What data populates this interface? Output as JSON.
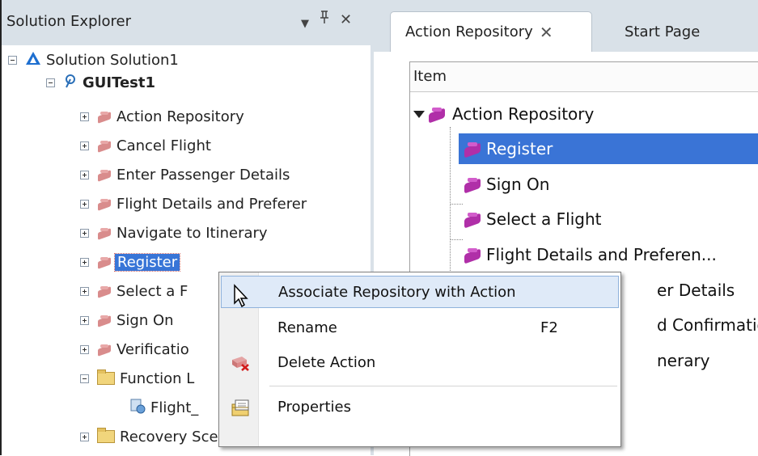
{
  "solution_explorer": {
    "title": "Solution Explorer",
    "header_buttons": {
      "dropdown": "▼",
      "pin": "ᛡ",
      "close": "✕"
    },
    "tree": [
      {
        "label": "Solution Solution1",
        "icon": "solution-icon",
        "expanded": true
      },
      {
        "label": "GUITest1",
        "icon": "test-icon",
        "expanded": true,
        "bold": true
      },
      {
        "label": "Action Repository",
        "icon": "action-icon"
      },
      {
        "label": "Cancel Flight",
        "icon": "action-icon"
      },
      {
        "label": "Enter Passenger Details",
        "icon": "action-icon"
      },
      {
        "label": "Flight Details and Preferer",
        "icon": "action-icon"
      },
      {
        "label": "Navigate to Itinerary",
        "icon": "action-icon"
      },
      {
        "label": "Register",
        "icon": "action-icon",
        "selected": true
      },
      {
        "label": "Select a F",
        "icon": "action-icon"
      },
      {
        "label": "Sign On",
        "icon": "action-icon"
      },
      {
        "label": "Verificatio",
        "icon": "action-icon"
      },
      {
        "label": "Function L",
        "icon": "folder-icon",
        "expanded": true
      },
      {
        "label": "Flight_",
        "icon": "function-library-icon"
      },
      {
        "label": "Recovery Scenarios",
        "icon": "folder-icon"
      }
    ]
  },
  "tabs": [
    {
      "label": "Action Repository",
      "active": true,
      "close": "✕"
    },
    {
      "label": "Start Page",
      "active": false
    }
  ],
  "repository_grid": {
    "column_header": "Item",
    "root": "Action Repository",
    "items": [
      {
        "label": "Register",
        "selected": true
      },
      {
        "label": "Sign On"
      },
      {
        "label": "Select a Flight"
      },
      {
        "label": "Flight Details and Preferen..."
      },
      {
        "label": "er Details"
      },
      {
        "label": "d Confirmation"
      },
      {
        "label": "nerary"
      }
    ]
  },
  "context_menu": {
    "items": [
      {
        "label": "Associate Repository with Action",
        "shortcut": "",
        "highlighted": true,
        "icon": "cursor-icon"
      },
      {
        "label": "Rename",
        "shortcut": "F2"
      },
      {
        "label": "Delete Action",
        "shortcut": "",
        "icon": "delete-action-icon"
      },
      {
        "label": "Properties",
        "shortcut": "",
        "icon": "properties-icon"
      }
    ]
  },
  "colors": {
    "header_bg": "#d9e1e8",
    "selection": "#3a74d6",
    "menu_highlight": "#dfeaf8",
    "action_brick": "#b02fa8"
  }
}
